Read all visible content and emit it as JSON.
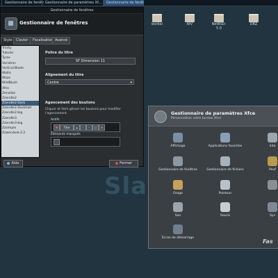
{
  "taskbar": {
    "items": [
      {
        "label": "Gestionnaire de fenêtres"
      },
      {
        "label": "Gestionnaire de paramètres Xf..."
      },
      {
        "label": "Gestionnaire de fenêtres"
      }
    ]
  },
  "desktop": {
    "icons": [
      {
        "label": "bordel",
        "icon": "folder-icon"
      },
      {
        "label": "AtV",
        "icon": "folder-icon"
      },
      {
        "label": "NetBSD-5.0",
        "icon": "folder-icon"
      },
      {
        "label": "DBZ",
        "icon": "folder-icon"
      }
    ],
    "watermark": "SlackWare",
    "corner_text": "Fas"
  },
  "wm_window": {
    "titlebar": "Gestionnaire de fenêtres",
    "header_title": "Gestionnaire de fenêtres",
    "tabs": [
      {
        "label": "Style"
      },
      {
        "label": "Clavier"
      },
      {
        "label": "Focalisation"
      },
      {
        "label": "Avancé"
      }
    ],
    "themes": [
      "Trinity",
      "Tubular",
      "Tyrex",
      "Variation",
      "Vertical-Blade",
      "Wallis",
      "Waza",
      "WildBlush",
      "Xfce",
      "Zenolize",
      "Zzendle2",
      "Zzendle2-Dark",
      "Zzendle2-DarkHalt",
      "Zzendle2-big",
      "Zzendle3",
      "Zzendle3-big",
      "Zzsimple",
      "Zzwendule-2.2"
    ],
    "selected_theme_index": 11,
    "font_label": "Police du titre",
    "font_value": "SF Dimension 11",
    "align_label": "Alignement du titre",
    "align_value": "Centre",
    "buttons_label": "Agencement des boutons",
    "buttons_help": "Cliquer et faire glisser les boutons pour modifier l'agencement",
    "active_label": "Actifs",
    "active_title_button": "Titre",
    "hidden_label": "Éléments masqués",
    "help_label": "Aide",
    "close_label": "Fermer"
  },
  "settings_window": {
    "title": "Gestionnaire de paramètres Xfce",
    "subtitle": "Personnaliser votre bureau Xfce",
    "items": [
      {
        "label": "Affichage",
        "icon": "display-icon",
        "color": "#7a8fa3"
      },
      {
        "label": "Applications favorites",
        "icon": "favorites-icon",
        "color": "#8aa0b8"
      },
      {
        "label": "Inte",
        "icon": "interface-icon",
        "color": "#9aa7b1"
      },
      {
        "label": "Gestionnaire de fenêtres",
        "icon": "window-manager-icon",
        "color": "#8c98a4"
      },
      {
        "label": "Gestionnaire de fichiers",
        "icon": "file-manager-icon",
        "color": "#a5b1bb"
      },
      {
        "label": "Peuf",
        "icon": "panel-icon",
        "color": "#b79a4e"
      },
      {
        "label": "Orage",
        "icon": "orage-icon",
        "color": "#c7a05b"
      },
      {
        "label": "Pointeur",
        "icon": "pointer-icon",
        "color": "#b9c2c8"
      },
      {
        "label": "",
        "icon": "extra-icon",
        "color": "#8a8f94"
      },
      {
        "label": "Son",
        "icon": "sound-icon",
        "color": "#9aa5ae"
      },
      {
        "label": "Souris",
        "icon": "mouse-icon",
        "color": "#c8cdd1"
      },
      {
        "label": "Sys",
        "icon": "system-icon",
        "color": "#7d8a95"
      },
      {
        "label": "Écran de démarrage",
        "icon": "splash-icon",
        "color": "#6f7f8d"
      }
    ]
  }
}
